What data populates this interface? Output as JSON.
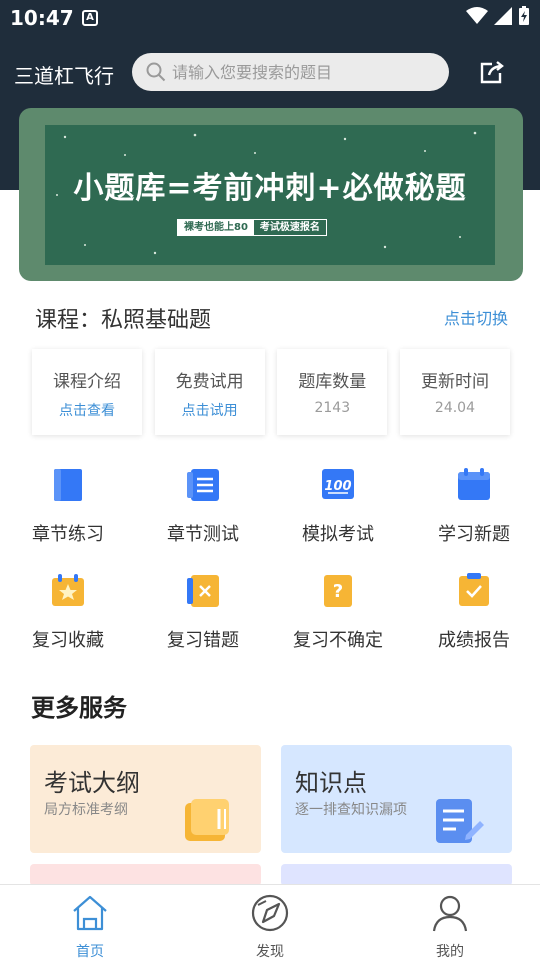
{
  "status_bar": {
    "time": "10:47",
    "notif_icon": "A"
  },
  "header": {
    "title": "三道杠飞行",
    "search_placeholder": "请输入您要搜索的题目"
  },
  "banner": {
    "title": "小题库=考前冲刺+必做秘题",
    "tag_left": "裸考也能上80",
    "tag_right": "考试极速报名"
  },
  "course": {
    "label": "课程：私照基础题",
    "switch_label": "点击切换"
  },
  "info_cards": [
    {
      "label": "课程介绍",
      "value": "点击查看"
    },
    {
      "label": "免费试用",
      "value": "点击试用"
    },
    {
      "label": "题库数量",
      "value": "2143"
    },
    {
      "label": "更新时间",
      "value": "24.04"
    }
  ],
  "features": [
    {
      "label": "章节练习",
      "icon": "book-icon"
    },
    {
      "label": "章节测试",
      "icon": "list-icon"
    },
    {
      "label": "模拟考试",
      "icon": "score-100-icon"
    },
    {
      "label": "学习新题",
      "icon": "calendar-icon"
    },
    {
      "label": "复习收藏",
      "icon": "star-calendar-icon"
    },
    {
      "label": "复习错题",
      "icon": "wrong-book-icon"
    },
    {
      "label": "复习不确定",
      "icon": "question-icon"
    },
    {
      "label": "成绩报告",
      "icon": "check-clipboard-icon"
    }
  ],
  "more_services": {
    "title": "更多服务",
    "items": [
      {
        "title": "考试大纲",
        "subtitle": "局方标准考纲",
        "icon": "books-icon",
        "bg": "#fcebd7"
      },
      {
        "title": "知识点",
        "subtitle": "逐一排查知识漏项",
        "icon": "notes-icon",
        "bg": "#d6e7ff"
      }
    ]
  },
  "bottom_nav": [
    {
      "label": "首页",
      "icon": "home-icon",
      "active": true
    },
    {
      "label": "发现",
      "icon": "compass-icon",
      "active": false
    },
    {
      "label": "我的",
      "icon": "user-icon",
      "active": false
    }
  ],
  "colors": {
    "accent": "#3d8fd6",
    "header_bg": "#1f2d3b",
    "banner_green": "#2f6a52",
    "icon_blue": "#3478f6",
    "icon_orange": "#f6b535"
  }
}
